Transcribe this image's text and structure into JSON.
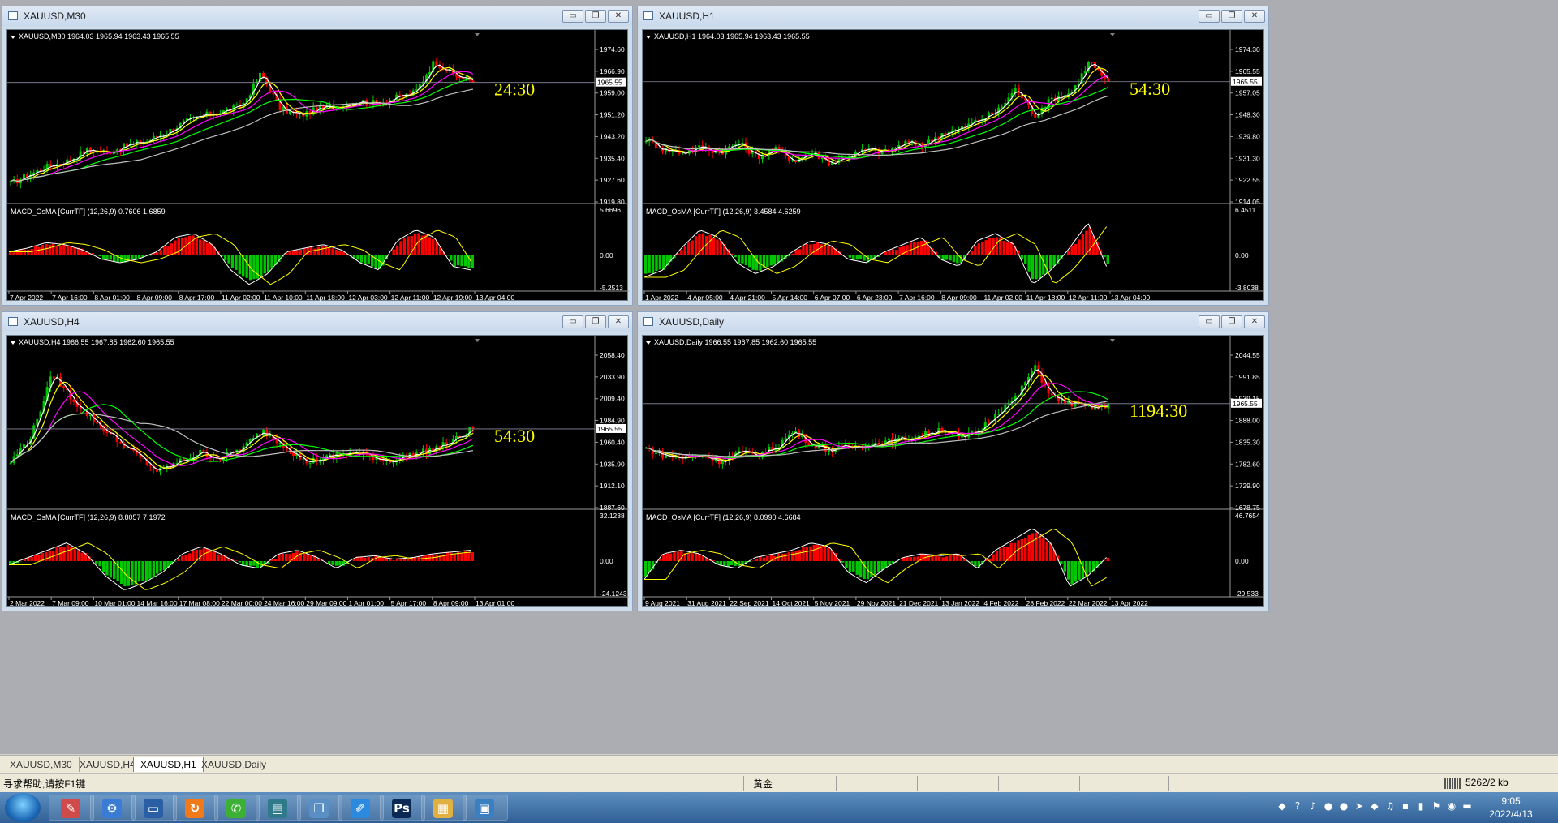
{
  "windows": [
    {
      "id": "m30",
      "title": "XAUUSD,M30",
      "header": "XAUUSD,M30  1964.03 1965.94 1963.43 1965.55",
      "timer": "24:30",
      "price_label": "1965.55",
      "price_ticks": [
        "1974.60",
        "1966.90",
        "1959.00",
        "1951.20",
        "1943.20",
        "1935.40",
        "1927.60",
        "1919.80"
      ],
      "macd_header": "MACD_OsMA [CurrTF] (12,26,9) 0.7606 1.6859",
      "macd_ticks": [
        "5.6696",
        "0.00",
        "-5.2513"
      ],
      "time_ticks": [
        "7 Apr 2022",
        "7 Apr 16:00",
        "8 Apr 01:00",
        "8 Apr 09:00",
        "8 Apr 17:00",
        "11 Apr 02:00",
        "11 Apr 10:00",
        "11 Apr 18:00",
        "12 Apr 03:00",
        "12 Apr 11:00",
        "12 Apr 19:00",
        "13 Apr 04:00"
      ]
    },
    {
      "id": "h1",
      "title": "XAUUSD,H1",
      "header": "XAUUSD,H1  1964.03 1965.94 1963.43 1965.55",
      "timer": "54:30",
      "price_label": "1965.55",
      "price_ticks": [
        "1974.30",
        "1965.55",
        "1957.05",
        "1948.30",
        "1939.80",
        "1931.30",
        "1922.55",
        "1914.05"
      ],
      "macd_header": "MACD_OsMA [CurrTF] (12,26,9) 3.4584 4.6259",
      "macd_ticks": [
        "6.4511",
        "0.00",
        "-3.8038"
      ],
      "time_ticks": [
        "1 Apr 2022",
        "4 Apr 05:00",
        "4 Apr 21:00",
        "5 Apr 14:00",
        "6 Apr 07:00",
        "6 Apr 23:00",
        "7 Apr 16:00",
        "8 Apr 09:00",
        "11 Apr 02:00",
        "11 Apr 18:00",
        "12 Apr 11:00",
        "13 Apr 04:00"
      ]
    },
    {
      "id": "h4",
      "title": "XAUUSD,H4",
      "header": "XAUUSD,H4  1966.55 1967.85 1962.60 1965.55",
      "timer": "54:30",
      "price_label": "1965.55",
      "price_ticks": [
        "2058.40",
        "2033.90",
        "2009.40",
        "1984.90",
        "1960.40",
        "1935.90",
        "1912.10",
        "1887.60"
      ],
      "macd_header": "MACD_OsMA [CurrTF] (12,26,9) 8.8057 7.1972",
      "macd_ticks": [
        "32.1238",
        "0.00",
        "-24.1243"
      ],
      "time_ticks": [
        "2 Mar 2022",
        "7 Mar 09:00",
        "10 Mar 01:00",
        "14 Mar 16:00",
        "17 Mar 08:00",
        "22 Mar 00:00",
        "24 Mar 16:00",
        "29 Mar 09:00",
        "1 Apr 01:00",
        "5 Apr 17:00",
        "8 Apr 09:00",
        "13 Apr 01:00"
      ]
    },
    {
      "id": "d1",
      "title": "XAUUSD,Daily",
      "header": "XAUUSD,Daily  1966.55 1967.85 1962.60 1965.55",
      "timer": "1194:30",
      "price_label": "1965.55",
      "price_ticks": [
        "2044.55",
        "1991.85",
        "1939.15",
        "1888.00",
        "1835.30",
        "1782.60",
        "1729.90",
        "1678.75"
      ],
      "macd_header": "MACD_OsMA [CurrTF] (12,26,9) 8.0990 4.6684",
      "macd_ticks": [
        "46.7654",
        "0.00",
        "-29.533"
      ],
      "time_ticks": [
        "9 Aug 2021",
        "31 Aug 2021",
        "22 Sep 2021",
        "14 Oct 2021",
        "5 Nov 2021",
        "29 Nov 2021",
        "21 Dec 2021",
        "13 Jan 2022",
        "4 Feb 2022",
        "28 Feb 2022",
        "22 Mar 2022",
        "13 Apr 2022"
      ]
    }
  ],
  "tabs": [
    "XAUUSD,M30",
    "XAUUSD,H4",
    "XAUUSD,H1",
    "XAUUSD,Daily"
  ],
  "active_tab": "XAUUSD,H1",
  "status": {
    "help": "寻求帮助,请按F1键",
    "profile": "黄金",
    "traffic": "5262/2 kb"
  },
  "clock": {
    "time": "9:05",
    "date": "2022/4/13"
  },
  "window_buttons": {
    "minimize": "▭",
    "restore": "❐",
    "close": "✕"
  },
  "taskbar_apps": [
    {
      "name": "paint-app",
      "glyph": "✎",
      "color": "#d04a4a"
    },
    {
      "name": "network-app",
      "glyph": "⚙",
      "color": "#3a7bd5"
    },
    {
      "name": "desktop-app",
      "glyph": "▭",
      "color": "#2a5fa5"
    },
    {
      "name": "browser-app",
      "glyph": "↻",
      "color": "#f07a1a"
    },
    {
      "name": "wechat-app",
      "glyph": "✆",
      "color": "#3cb034"
    },
    {
      "name": "trading-app",
      "glyph": "▤",
      "color": "#2f7a8a"
    },
    {
      "name": "files-app",
      "glyph": "❒",
      "color": "#5a8fc5"
    },
    {
      "name": "note-app",
      "glyph": "✐",
      "color": "#2b8ae0"
    },
    {
      "name": "photoshop-app",
      "glyph": "Ps",
      "color": "#0a2a55"
    },
    {
      "name": "explorer-app",
      "glyph": "▦",
      "color": "#e0b040"
    },
    {
      "name": "viewer-app",
      "glyph": "▣",
      "color": "#3a7fc0"
    }
  ],
  "tray_icons": [
    "shield-icon",
    "help-icon",
    "bell-icon",
    "chat-icon",
    "chat-icon",
    "arrow-icon",
    "shield-icon",
    "volume-icon",
    "network-icon",
    "signal-icon",
    "flag-icon",
    "antivirus-icon",
    "battery-icon"
  ],
  "colors": {
    "chart_bg": "#000000",
    "bull": "#00c800",
    "bear": "#ff0000",
    "ma_fast": "#ffffff",
    "ma_yellow": "#ffff00",
    "ma_magenta": "#ff00ff",
    "ma_green": "#00ff00",
    "ma_gray": "#c0c0c0",
    "timer": "#ffff00"
  }
}
